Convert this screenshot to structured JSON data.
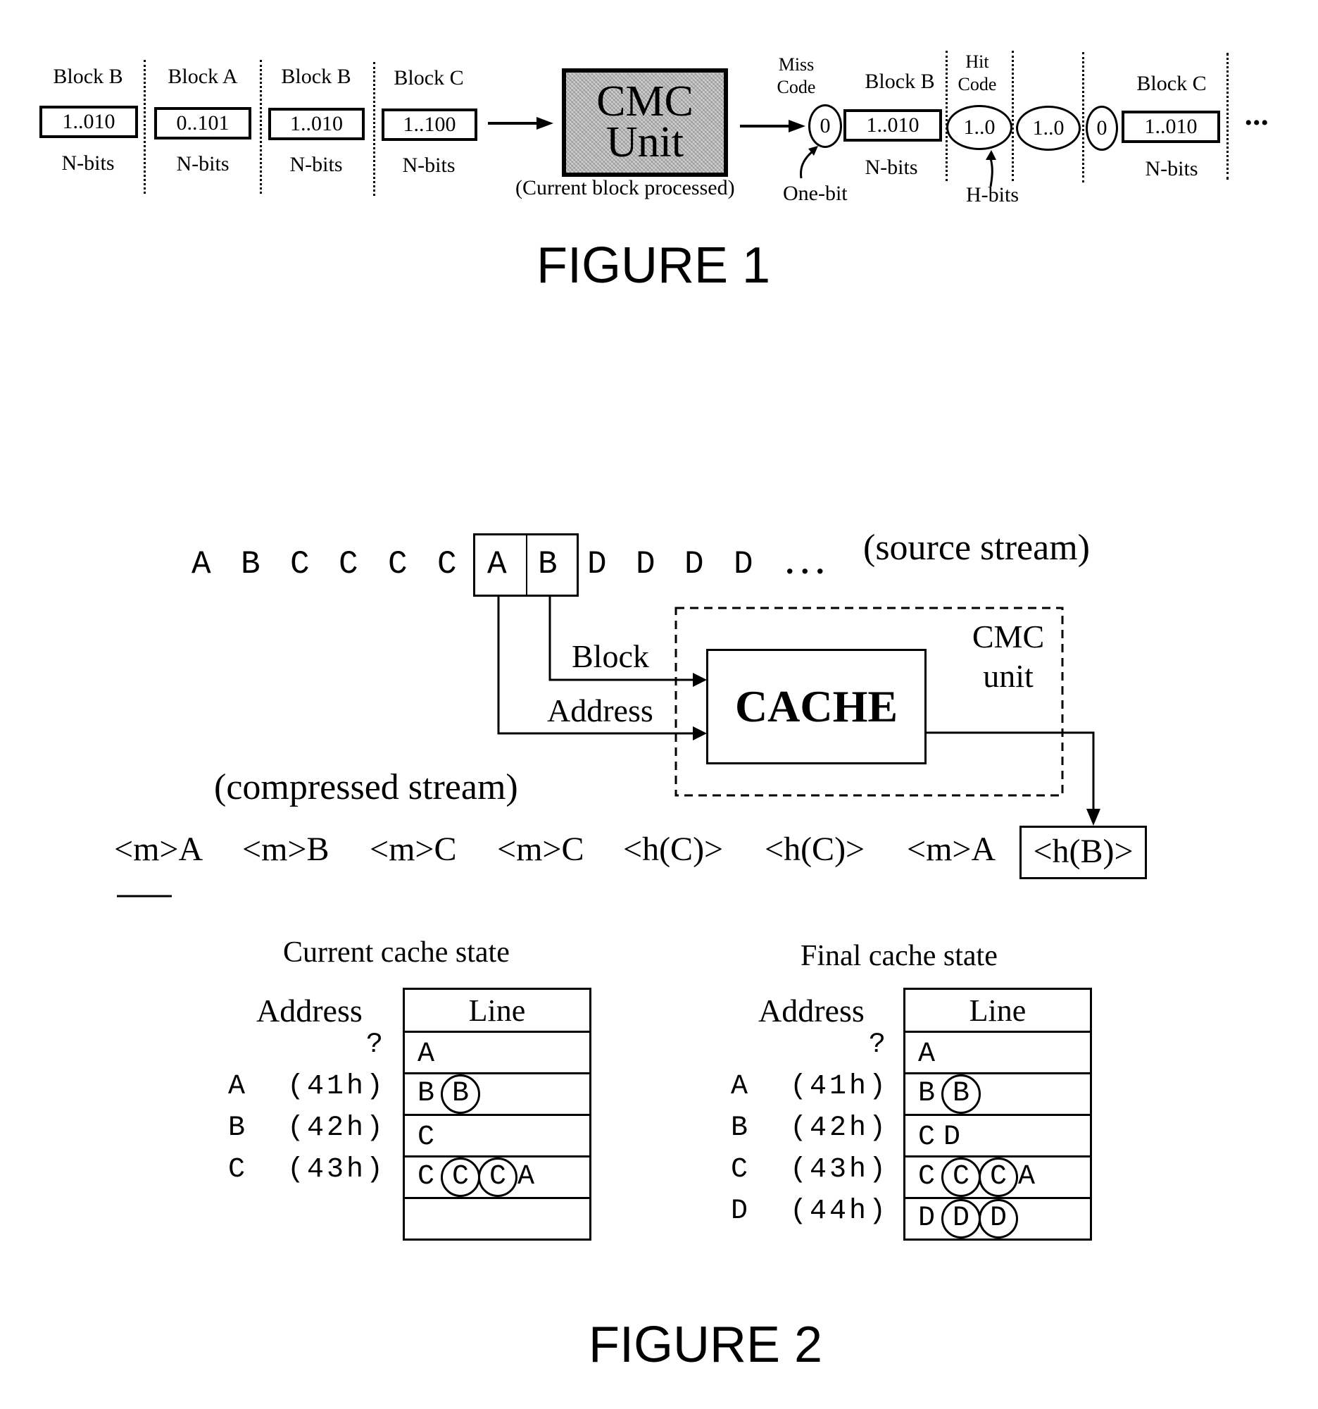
{
  "figure1": {
    "title": "FIGURE 1",
    "input_blocks": [
      {
        "label": "Block B",
        "value": "1..010",
        "size": "N-bits"
      },
      {
        "label": "Block A",
        "value": "0..101",
        "size": "N-bits"
      },
      {
        "label": "Block B",
        "value": "1..010",
        "size": "N-bits"
      },
      {
        "label": "Block C",
        "value": "1..100",
        "size": "N-bits"
      }
    ],
    "cmc_unit": {
      "line1": "CMC",
      "line2": "Unit",
      "caption": "(Current block processed)"
    },
    "output": {
      "miss_code_label": "Miss Code",
      "miss_code_line1": "Miss",
      "miss_code_line2": "Code",
      "miss_bit": "0",
      "block_b_label": "Block B",
      "block_b_value": "1..010",
      "block_b_size": "N-bits",
      "hit_code_line1": "Hit",
      "hit_code_line2": "Code",
      "hit_value_1": "1..0",
      "hit_value_2": "1..0",
      "miss_bit_2": "0",
      "block_c_label": "Block C",
      "block_c_value": "1..010",
      "block_c_size": "N-bits",
      "ellipsis": "•••",
      "one_bit_annotation": "One-bit",
      "h_bits_annotation": "H-bits"
    }
  },
  "figure2": {
    "title": "FIGURE 2",
    "source_stream": {
      "chars": [
        "A",
        "B",
        "C",
        "C",
        "C",
        "C",
        "A",
        "B",
        "D",
        "D",
        "D",
        "D"
      ],
      "highlighted": [
        6,
        7
      ],
      "ellipsis": "...",
      "label": "(source stream)"
    },
    "cache_box": {
      "label": "CACHE",
      "unit_line1": "CMC",
      "unit_line2": "unit"
    },
    "inputs": {
      "block": "Block",
      "address": "Address"
    },
    "compressed_stream": {
      "label": "(compressed stream)",
      "tokens": [
        "<m>A",
        "<m>B",
        "<m>C",
        "<m>C",
        "<h(C)>",
        "<h(C)>",
        "<m>A",
        "<h(B)>"
      ],
      "highlighted_index": 7
    },
    "current_cache": {
      "title": "Current cache state",
      "address_header": "Address",
      "line_header": "Line",
      "rows": [
        {
          "address": "?",
          "line": [
            {
              "c": "A",
              "hit": false
            }
          ]
        },
        {
          "address": "A  (41h)",
          "line": [
            {
              "c": "B",
              "hit": false
            },
            {
              "c": "B",
              "hit": true
            }
          ]
        },
        {
          "address": "B  (42h)",
          "line": [
            {
              "c": "C",
              "hit": false
            }
          ]
        },
        {
          "address": "C  (43h)",
          "line": [
            {
              "c": "C",
              "hit": false
            },
            {
              "c": "C",
              "hit": true
            },
            {
              "c": "C",
              "hit": true
            },
            {
              "c": "A",
              "hit": false
            }
          ]
        },
        {
          "address": "",
          "line": []
        }
      ]
    },
    "final_cache": {
      "title": "Final cache state",
      "address_header": "Address",
      "line_header": "Line",
      "rows": [
        {
          "address": "?",
          "line": [
            {
              "c": "A",
              "hit": false
            }
          ]
        },
        {
          "address": "A  (41h)",
          "line": [
            {
              "c": "B",
              "hit": false
            },
            {
              "c": "B",
              "hit": true
            }
          ]
        },
        {
          "address": "B  (42h)",
          "line": [
            {
              "c": "C",
              "hit": false
            },
            {
              "c": "D",
              "hit": false
            }
          ]
        },
        {
          "address": "C  (43h)",
          "line": [
            {
              "c": "C",
              "hit": false
            },
            {
              "c": "C",
              "hit": true
            },
            {
              "c": "C",
              "hit": true
            },
            {
              "c": "A",
              "hit": false
            }
          ]
        },
        {
          "address": "D  (44h)",
          "line": [
            {
              "c": "D",
              "hit": false
            },
            {
              "c": "D",
              "hit": true
            },
            {
              "c": "D",
              "hit": true
            }
          ]
        }
      ]
    }
  }
}
